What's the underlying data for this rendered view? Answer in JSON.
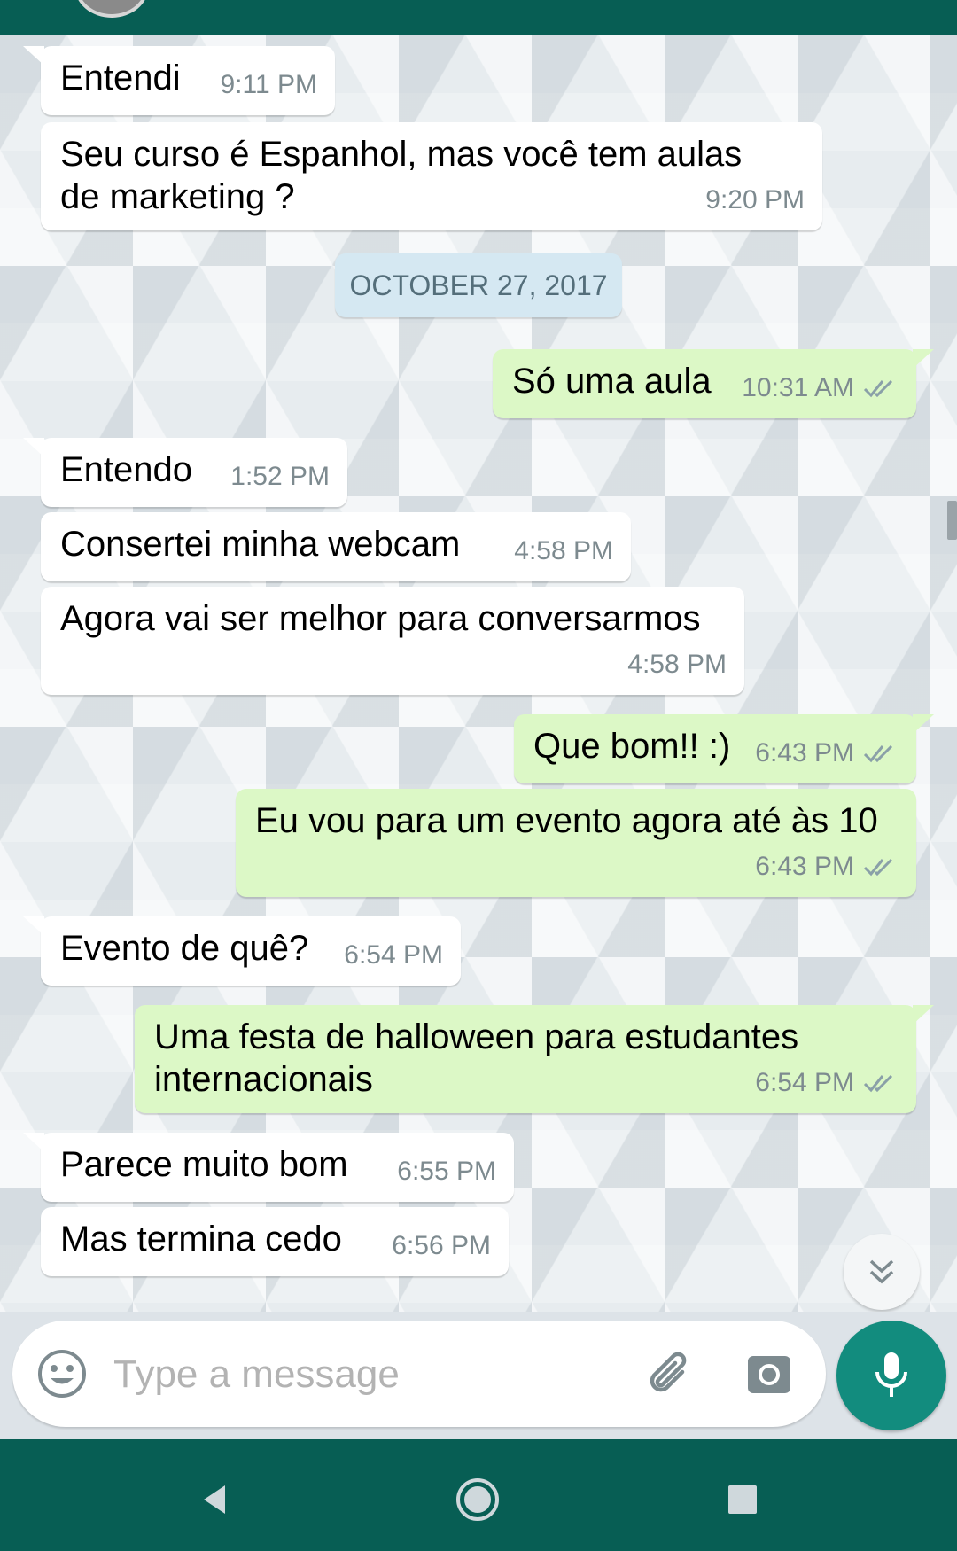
{
  "colors": {
    "header": "#075e54",
    "incoming_bubble": "#ffffff",
    "outgoing_bubble": "#dcf8c6",
    "date_chip": "#d5e8f2",
    "mic_button": "#128c7e",
    "timestamp": "#7d8a8f",
    "ticks": "#8aa0a8"
  },
  "date_separator": "OCTOBER 27, 2017",
  "messages": [
    {
      "direction": "in",
      "text": "Entendi",
      "time": "9:11 PM"
    },
    {
      "direction": "in",
      "text": "Seu curso é Espanhol, mas você tem aulas\nde marketing ?",
      "time": "9:20 PM"
    },
    {
      "direction": "out",
      "text": "Só uma aula",
      "time": "10:31 AM",
      "status": "double-check-icon"
    },
    {
      "direction": "in",
      "text": "Entendo",
      "time": "1:52 PM"
    },
    {
      "direction": "in",
      "text": "Consertei minha webcam",
      "time": "4:58 PM"
    },
    {
      "direction": "in",
      "text": "Agora vai ser melhor para conversarmos",
      "time": "4:58 PM"
    },
    {
      "direction": "out",
      "text": "Que bom!! :)",
      "time": "6:43 PM",
      "status": "double-check-icon"
    },
    {
      "direction": "out",
      "text": "Eu vou para um evento agora até às 10",
      "time": "6:43 PM",
      "status": "double-check-icon"
    },
    {
      "direction": "in",
      "text": "Evento de quê?",
      "time": "6:54 PM"
    },
    {
      "direction": "out",
      "text": "Uma festa de halloween para estudantes\ninternacionais",
      "time": "6:54 PM",
      "status": "double-check-icon"
    },
    {
      "direction": "in",
      "text": "Parece muito bom",
      "time": "6:55 PM"
    },
    {
      "direction": "in",
      "text": "Mas termina cedo",
      "time": "6:56 PM"
    }
  ],
  "composer": {
    "placeholder": "Type a message",
    "emoji_icon": "emoji-icon",
    "attach_icon": "paperclip-icon",
    "camera_icon": "camera-icon",
    "mic_icon": "microphone-icon"
  },
  "scroll_down_icon": "double-chevron-down-icon",
  "navigation": {
    "back_icon": "back-triangle-icon",
    "home_icon": "home-circle-icon",
    "recents_icon": "recents-square-icon"
  }
}
